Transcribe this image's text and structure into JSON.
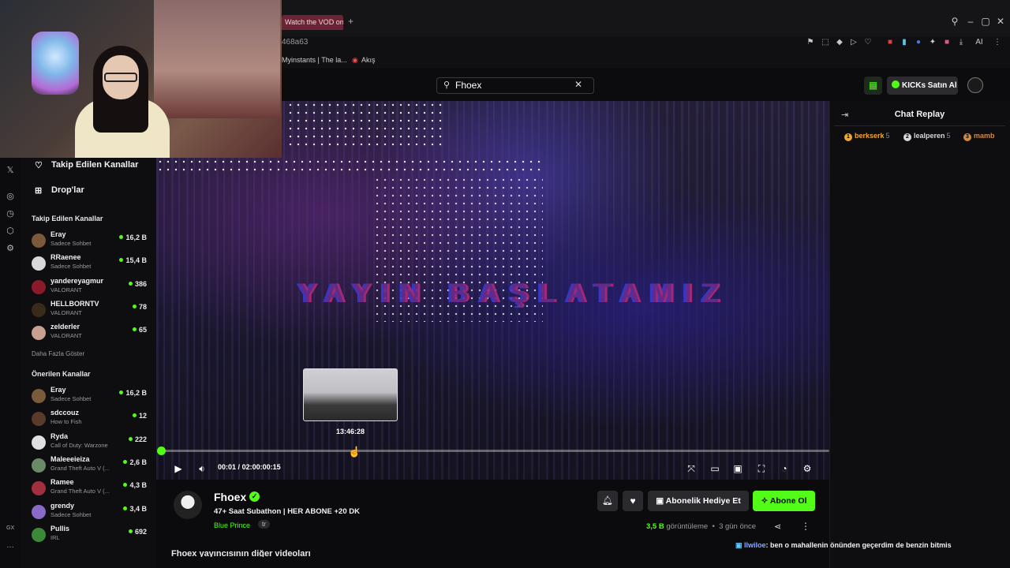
{
  "browser": {
    "active_tab": "Watch the VOD on",
    "url": "468a63",
    "bookmarks": [
      "Myinstants | The la...",
      "Akış"
    ],
    "ai_label": "AI"
  },
  "header": {
    "search_value": "Fhoex",
    "kicks_label": "KICKs Satın Al"
  },
  "sidebar": {
    "nav": [
      "Takip Edilen Kanallar",
      "Drop'lar"
    ],
    "followed_title": "Takip Edilen Kanallar",
    "followed": [
      {
        "name": "Eray",
        "category": "Sadece Sohbet",
        "viewers": "16,2 B",
        "color": "#7a5a3a"
      },
      {
        "name": "RRaenee",
        "category": "Sadece Sohbet",
        "viewers": "15,4 B",
        "color": "#d8d8d8"
      },
      {
        "name": "yandereyagmur",
        "category": "VALORANT",
        "viewers": "386",
        "color": "#8a1a2a"
      },
      {
        "name": "HELLBORNTV",
        "category": "VALORANT",
        "viewers": "78",
        "color": "#3a2a1a"
      },
      {
        "name": "zelderler",
        "category": "VALORANT",
        "viewers": "65",
        "color": "#c8a090"
      }
    ],
    "show_more": "Daha Fazla Göster",
    "recommended_title": "Önerilen Kanallar",
    "recommended": [
      {
        "name": "Eray",
        "category": "Sadece Sohbet",
        "viewers": "16,2 B",
        "color": "#7a5a3a"
      },
      {
        "name": "sdccouz",
        "category": "How to Fish",
        "viewers": "12",
        "color": "#5a3a2a"
      },
      {
        "name": "Ryda",
        "category": "Call of Duty: Warzone",
        "viewers": "222",
        "color": "#e0e0e0"
      },
      {
        "name": "Maleeeieiza",
        "category": "Grand Theft Auto V (...",
        "viewers": "2,6 B",
        "color": "#6a8a6a"
      },
      {
        "name": "Ramee",
        "category": "Grand Theft Auto V (...",
        "viewers": "4,3 B",
        "color": "#a03040"
      },
      {
        "name": "grendy",
        "category": "Sadece Sohbet",
        "viewers": "3,4 B",
        "color": "#8a6ac8"
      },
      {
        "name": "Pullis",
        "category": "IRL",
        "viewers": "692",
        "color": "#3a8a3a"
      }
    ]
  },
  "player": {
    "preview_time": "13:46:28",
    "current_time": "00:01",
    "separator": "/",
    "duration": "02:00:00:15",
    "progress_fraction": 0.0,
    "overlay_text": "YAYIN BAŞLATAMIZ"
  },
  "chat": {
    "title": "Chat Replay",
    "gifters": [
      {
        "rank": "1",
        "name": "berkserk",
        "count": "5",
        "color": "#f0a830"
      },
      {
        "rank": "2",
        "name": "lealperen",
        "count": "5",
        "color": "#d8d8d8"
      },
      {
        "rank": "3",
        "name": "mamb",
        "count": "",
        "color": "#d08a40"
      }
    ],
    "message_user": "llwiloe",
    "message_text": ": ben o mahallenin önünden geçerdim de benzin bitmis"
  },
  "channel": {
    "name": "Fhoex",
    "title": "47+ Saat Subathon | HER ABONE +20 DK",
    "game": "Blue Prince",
    "lang": "tr",
    "gift_label": "Abonelik Hediye Et",
    "sub_label": "Abone Ol",
    "views": "3,5 B",
    "views_suffix": "görüntüleme",
    "age": "3 gün önce",
    "other_videos": "Fhoex yayıncısının diğer videoları"
  },
  "rail": {
    "gx": "GX"
  }
}
